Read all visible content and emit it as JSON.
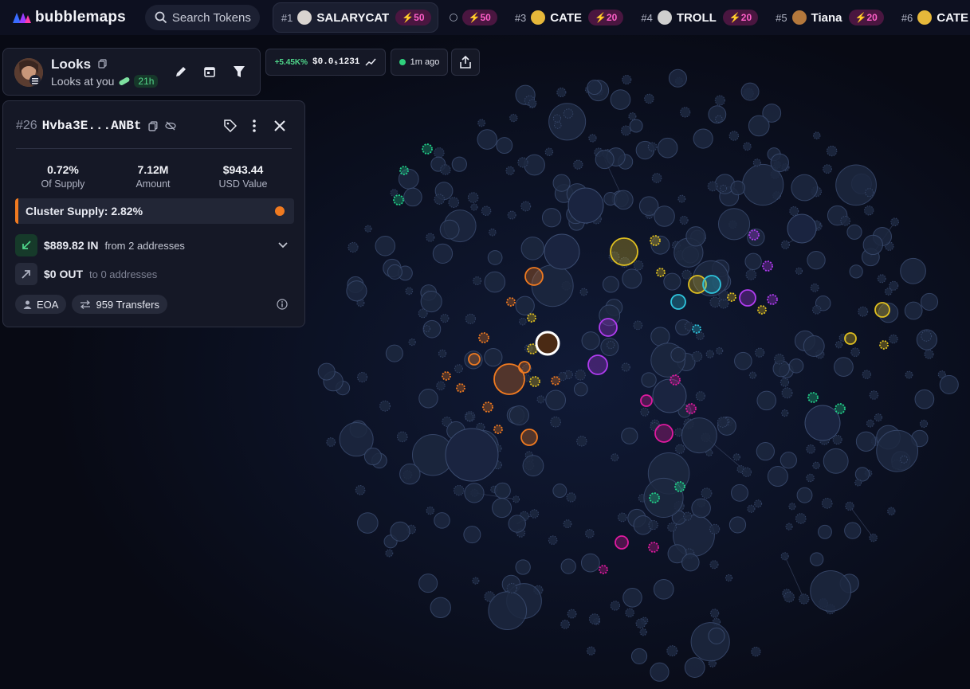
{
  "app": {
    "brand": "bubblemaps",
    "search_placeholder": "Search Tokens"
  },
  "trending": [
    {
      "rank": "#1",
      "name": "SALARYCAT",
      "boost": "50",
      "icon_color": "#d9d4d0"
    },
    {
      "rank": "",
      "name": "",
      "boost": "50",
      "icon_color": "#888ea0"
    },
    {
      "rank": "#3",
      "name": "CATE",
      "boost": "20",
      "icon_color": "#e6b83a"
    },
    {
      "rank": "#4",
      "name": "TROLL",
      "boost": "20",
      "icon_color": "#cfcfcf"
    },
    {
      "rank": "#5",
      "name": "Tiana",
      "boost": "20",
      "icon_color": "#b4783c"
    },
    {
      "rank": "#6",
      "name": "CATE",
      "boost": "",
      "icon_color": "#e6b83a"
    }
  ],
  "header": {
    "title": "Looks",
    "subtitle": "Looks at you",
    "age": "21h"
  },
  "price": {
    "change": "+5.45K%",
    "value": "$0.0₅1231"
  },
  "updated": "1m ago",
  "detail": {
    "rank": "#26",
    "address": "Hvba3E...ANBt",
    "stats": [
      {
        "value": "0.72%",
        "label": "Of Supply"
      },
      {
        "value": "7.12M",
        "label": "Amount"
      },
      {
        "value": "$943.44",
        "label": "USD Value"
      }
    ],
    "cluster_supply": "Cluster Supply: 2.82%",
    "inflow": {
      "amount": "$889.82 IN",
      "from": "from 2 addresses"
    },
    "outflow": {
      "amount": "$0 OUT",
      "to": "to 0 addresses"
    },
    "tags": {
      "type": "EOA",
      "transfers": "959 Transfers"
    }
  },
  "colors": {
    "background": "#080a14",
    "bubble_default": "#1d2840",
    "bubble_stroke": "#3b4c70",
    "orange": "#f07a20",
    "yellow": "#e0c020",
    "cyan": "#2ec4dc",
    "purple": "#b03cf0",
    "magenta": "#e01aa0",
    "green": "#22d08a",
    "boost_pink": "#ff5fc8"
  }
}
